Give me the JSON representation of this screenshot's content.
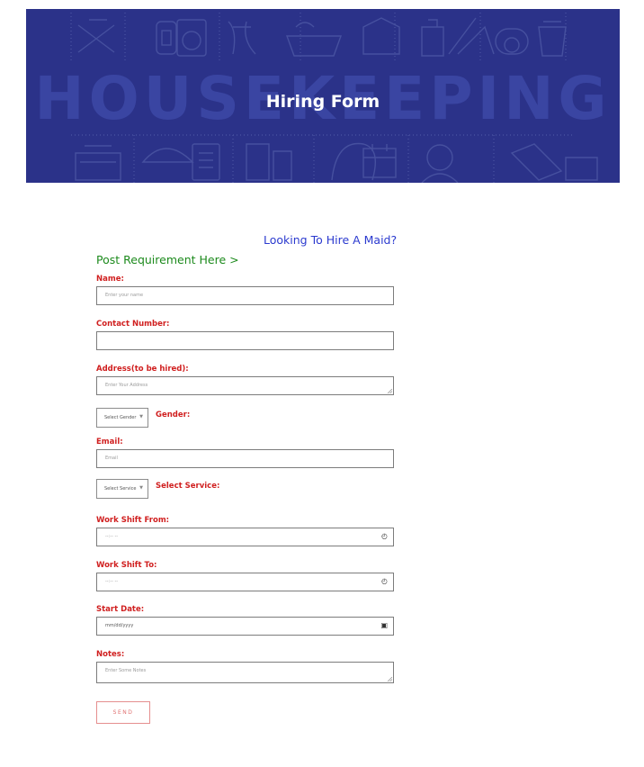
{
  "banner": {
    "background_word": "HOUSEKEEPING",
    "title": "Hiring Form",
    "color": "#2b3289"
  },
  "form": {
    "heading": "Looking To Hire A Maid?",
    "subheading": "Post Requirement Here >",
    "name": {
      "label": "Name:",
      "placeholder": "Enter your name"
    },
    "contact": {
      "label": "Contact Number:",
      "placeholder": ""
    },
    "address": {
      "label": "Address(to be hired):",
      "placeholder": "Enter Your Address"
    },
    "gender": {
      "label": "Gender:",
      "selected": "Select Gender"
    },
    "email": {
      "label": "Email:",
      "placeholder": "Email"
    },
    "service": {
      "label": "Select Service:",
      "selected": "Select Service"
    },
    "shift_from": {
      "label": "Work Shift From:",
      "value": "--:-- --",
      "icon": "clock-icon"
    },
    "shift_to": {
      "label": "Work Shift To:",
      "value": "--:-- --",
      "icon": "clock-icon"
    },
    "start_date": {
      "label": "Start Date:",
      "value": "mm/dd/yyyy",
      "icon": "calendar-icon"
    },
    "notes": {
      "label": "Notes:",
      "placeholder": "Enter Some Notes"
    },
    "send_label": "SEND"
  },
  "colors": {
    "label": "#d01f1f",
    "heading": "#2b3acf",
    "subheading": "#1c8a1c",
    "send_border": "#e58f8f"
  }
}
